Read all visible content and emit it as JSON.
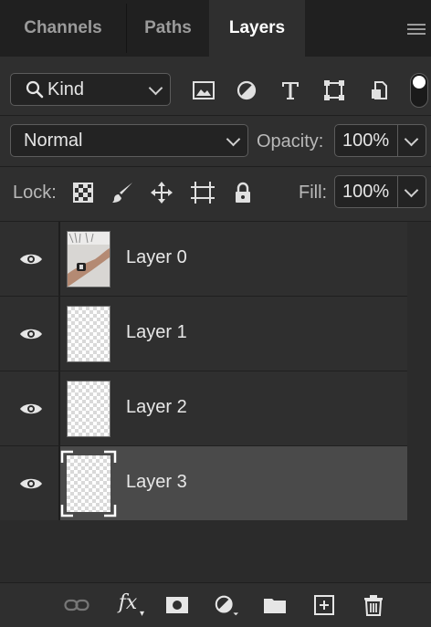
{
  "tabs": [
    {
      "label": "Channels"
    },
    {
      "label": "Paths"
    },
    {
      "label": "Layers",
      "active": true
    }
  ],
  "filter": {
    "kind_value": "Kind",
    "icons": [
      "image-filter-icon",
      "adjustment-filter-icon",
      "type-filter-icon",
      "shape-filter-icon",
      "smart-object-filter-icon",
      "filter-toggle-icon"
    ]
  },
  "blend": {
    "mode_value": "Normal",
    "opacity_label": "Opacity:",
    "opacity_value": "100%"
  },
  "lock": {
    "label": "Lock:",
    "icons": [
      "lock-transparent-pixels-icon",
      "lock-image-pixels-icon",
      "lock-position-icon",
      "lock-artboard-icon",
      "lock-all-icon"
    ],
    "fill_label": "Fill:",
    "fill_value": "100%"
  },
  "layers": [
    {
      "name": "Layer 0",
      "visible": true,
      "thumbnail": "photo"
    },
    {
      "name": "Layer 1",
      "visible": true,
      "thumbnail": "transparent"
    },
    {
      "name": "Layer 2",
      "visible": true,
      "thumbnail": "transparent"
    },
    {
      "name": "Layer 3",
      "visible": true,
      "thumbnail": "transparent",
      "selected": true
    }
  ],
  "bottom_toolbar": {
    "icons": [
      "link-layers-icon",
      "layer-style-fx-icon",
      "add-mask-icon",
      "new-adjustment-layer-icon",
      "new-group-icon",
      "new-layer-icon",
      "delete-layer-icon"
    ],
    "fx_label": "fx"
  },
  "colors": {
    "panel_bg": "#2f2f2f",
    "tab_bar_bg": "#202020",
    "selected_layer_bg": "#4a4a4a",
    "text": "#e8e8e8"
  }
}
